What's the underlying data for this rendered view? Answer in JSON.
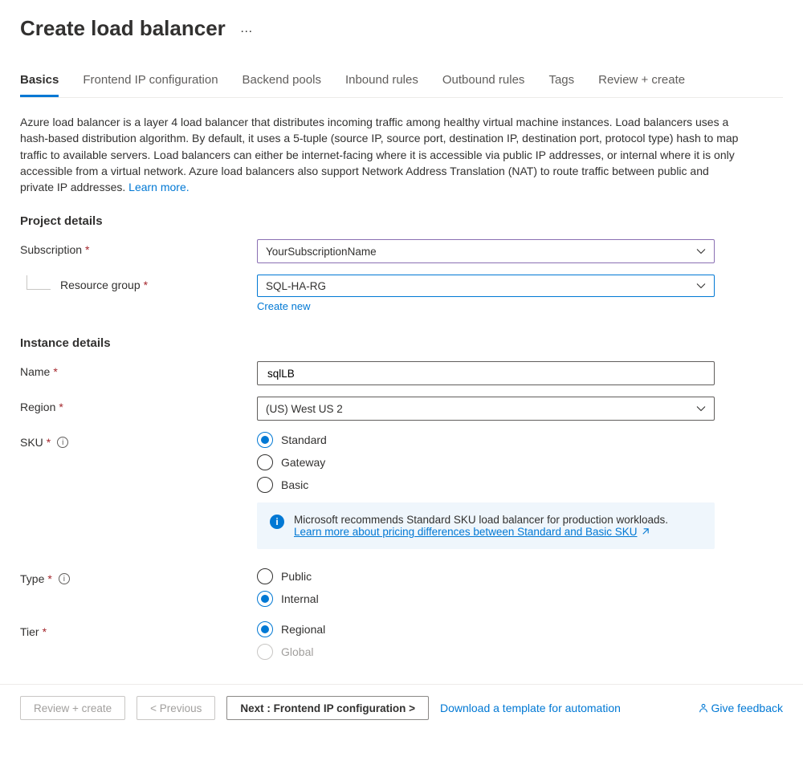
{
  "header": {
    "title": "Create load balancer",
    "more_actions": "…"
  },
  "tabs": [
    {
      "label": "Basics",
      "active": true
    },
    {
      "label": "Frontend IP configuration",
      "active": false
    },
    {
      "label": "Backend pools",
      "active": false
    },
    {
      "label": "Inbound rules",
      "active": false
    },
    {
      "label": "Outbound rules",
      "active": false
    },
    {
      "label": "Tags",
      "active": false
    },
    {
      "label": "Review + create",
      "active": false
    }
  ],
  "intro": {
    "text": "Azure load balancer is a layer 4 load balancer that distributes incoming traffic among healthy virtual machine instances. Load balancers uses a hash-based distribution algorithm. By default, it uses a 5-tuple (source IP, source port, destination IP, destination port, protocol type) hash to map traffic to available servers. Load balancers can either be internet-facing where it is accessible via public IP addresses, or internal where it is only accessible from a virtual network. Azure load balancers also support Network Address Translation (NAT) to route traffic between public and private IP addresses.  ",
    "learn_more": "Learn more."
  },
  "sections": {
    "project": {
      "title": "Project details",
      "subscription": {
        "label": "Subscription",
        "value": "YourSubscriptionName"
      },
      "resource_group": {
        "label": "Resource group",
        "value": "SQL-HA-RG",
        "create_new": "Create new"
      }
    },
    "instance": {
      "title": "Instance details",
      "name": {
        "label": "Name",
        "value": "sqlLB"
      },
      "region": {
        "label": "Region",
        "value": "(US) West US 2"
      },
      "sku": {
        "label": "SKU",
        "options": [
          "Standard",
          "Gateway",
          "Basic"
        ],
        "selected": "Standard",
        "info": {
          "text": "Microsoft recommends Standard SKU load balancer for production workloads.",
          "link_text": "Learn more about pricing differences between Standard and Basic SKU"
        }
      },
      "type": {
        "label": "Type",
        "options": [
          "Public",
          "Internal"
        ],
        "selected": "Internal"
      },
      "tier": {
        "label": "Tier",
        "options": [
          "Regional",
          "Global"
        ],
        "selected": "Regional",
        "disabled": [
          "Global"
        ]
      }
    }
  },
  "footer": {
    "review_create": "Review + create",
    "previous": "< Previous",
    "next": "Next : Frontend IP configuration >",
    "download_template": "Download a template for automation",
    "give_feedback": "Give feedback"
  }
}
